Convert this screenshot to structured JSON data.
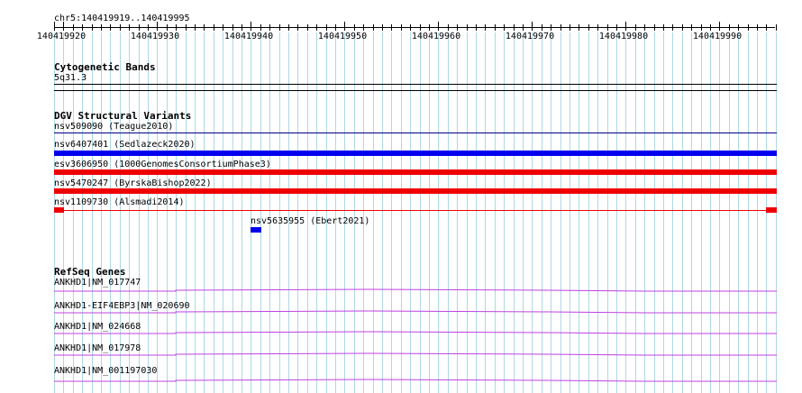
{
  "region": "chr5:140419919..140419995",
  "ruler": {
    "ticks": [
      "140419920",
      "140419930",
      "140419940",
      "140419950",
      "140419960",
      "140419970",
      "140419980",
      "140419990"
    ]
  },
  "tracks": {
    "cytoband": {
      "title": "Cytogenetic Bands",
      "band": "5q31.3"
    },
    "dgv": {
      "title": "DGV Structural Variants",
      "features": [
        {
          "label": "nsv509090 (Teague2010)",
          "color": "#00008b"
        },
        {
          "label": "nsv6407401 (Sedlazeck2020)",
          "color": "#0000ee"
        },
        {
          "label": "esv3606950 (1000GenomesConsortiumPhase3)",
          "color": "#ee0000"
        },
        {
          "label": "nsv5470247 (ByrskaBishop2022)",
          "color": "#ee0000"
        },
        {
          "label": "nsv1109730 (Alsmadi2014)",
          "color": "#ee0000"
        },
        {
          "label": "nsv5635955 (Ebert2021)",
          "color": "#0000ee"
        }
      ]
    },
    "refseq": {
      "title": "RefSeq Genes",
      "genes": [
        {
          "label": "ANKHD1|NM_017747"
        },
        {
          "label": "ANKHD1-EIF4EBP3|NM_020690"
        },
        {
          "label": "ANKHD1|NM_024668"
        },
        {
          "label": "ANKHD1|NM_017978"
        },
        {
          "label": "ANKHD1|NM_001197030"
        }
      ],
      "color": "#c040e0"
    }
  },
  "colors": {
    "grid": "#add8e6",
    "text": "#000000"
  }
}
